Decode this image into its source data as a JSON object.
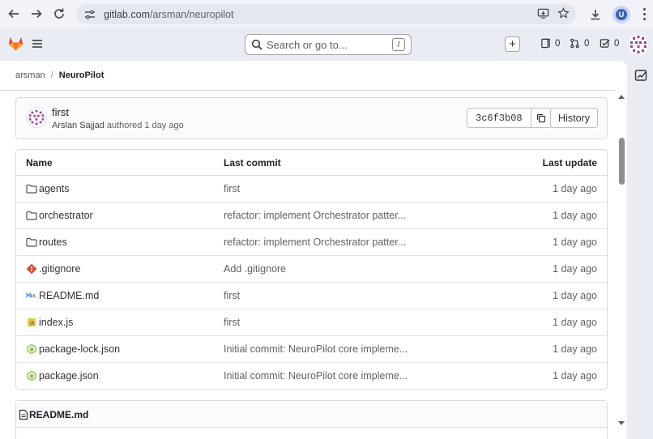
{
  "browser": {
    "url_host": "gitlab.com",
    "url_path": "/arsman/neuropilot",
    "profile_initial": "U"
  },
  "topbar": {
    "search_placeholder": "Search or go to...",
    "search_shortcut": "/",
    "create_label": "+",
    "issues_count": "0",
    "merge_requests_count": "0",
    "todos_count": "0"
  },
  "breadcrumb": {
    "owner": "arsman",
    "separator": "/",
    "project": "NeuroPilot"
  },
  "last_commit": {
    "title": "first",
    "author": "Arslan Sajjad",
    "meta_suffix": "authored 1 day ago",
    "sha": "3c6f3b08",
    "history_label": "History"
  },
  "table": {
    "headers": {
      "name": "Name",
      "commit": "Last commit",
      "updated": "Last update"
    },
    "rows": [
      {
        "name": "agents",
        "icon": "folder-icon",
        "commit": "first",
        "updated": "1 day ago"
      },
      {
        "name": "orchestrator",
        "icon": "folder-icon",
        "commit": "refactor: implement Orchestrator patter...",
        "updated": "1 day ago"
      },
      {
        "name": "routes",
        "icon": "folder-icon",
        "commit": "refactor: implement Orchestrator patter...",
        "updated": "1 day ago"
      },
      {
        "name": ".gitignore",
        "icon": "git-file-icon",
        "commit": "Add .gitignore",
        "updated": "1 day ago"
      },
      {
        "name": "README.md",
        "icon": "markdown-file-icon",
        "commit": "first",
        "updated": "1 day ago"
      },
      {
        "name": "index.js",
        "icon": "js-file-icon",
        "commit": "first",
        "updated": "1 day ago"
      },
      {
        "name": "package-lock.json",
        "icon": "node-file-icon",
        "commit": "Initial commit: NeuroPilot core impleme...",
        "updated": "1 day ago"
      },
      {
        "name": "package.json",
        "icon": "node-file-icon",
        "commit": "Initial commit: NeuroPilot core impleme...",
        "updated": "1 day ago"
      }
    ]
  },
  "readme": {
    "title": "README.md"
  },
  "colors": {
    "gitlab_orange": "#e24329",
    "folder": "#535158",
    "gitignore": "#dd4b28",
    "markdown": "#5a8fd8",
    "js": "#e8c44a",
    "node": "#8cc84b"
  }
}
